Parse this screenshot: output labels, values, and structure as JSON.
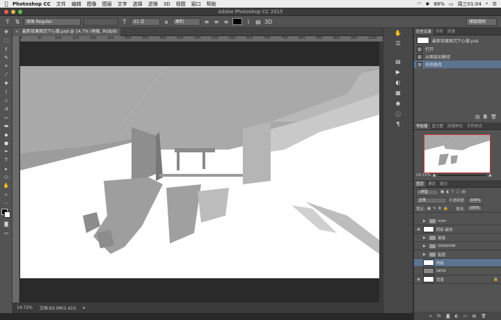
{
  "menubar": {
    "apple_icon": "apple-icon",
    "app_name": "Photoshop CC",
    "items": [
      "文件",
      "编辑",
      "图像",
      "图层",
      "文字",
      "选择",
      "滤镜",
      "3D",
      "视图",
      "窗口",
      "帮助"
    ],
    "battery": "88%",
    "clock": "周三01:04"
  },
  "window": {
    "title": "Adobe Photoshop CC 2015"
  },
  "options": {
    "font_family": "宋体 Regular",
    "font_size": "21 点",
    "aa_mode": "犀利",
    "workspace": "排版规则"
  },
  "document": {
    "tab_title": "最新效果图沉下心做.psd @ 14.7% (地板, RGB/8) *",
    "zoom": "14.72%",
    "doc_size": "文档:83.0M/1.41G"
  },
  "ruler_marks": [
    "0",
    "50",
    "100",
    "150",
    "200",
    "250",
    "300",
    "350",
    "400",
    "450",
    "500",
    "550",
    "600",
    "650",
    "700",
    "750",
    "800",
    "850",
    "900",
    "950",
    "1000"
  ],
  "history": {
    "tabs": [
      "历史记录",
      "字符",
      "段落"
    ],
    "snapshot": "最新效果图沉下心做.psd",
    "items": [
      {
        "label": "打开"
      },
      {
        "label": "从图层创建组"
      },
      {
        "label": "名称更改"
      }
    ]
  },
  "navigator": {
    "tabs": [
      "导航器",
      "直方图",
      "段落样式",
      "字符样式"
    ],
    "zoom": "14.72%"
  },
  "layers": {
    "tabs": [
      "图层",
      "通道",
      "路径"
    ],
    "filter_label": "类型",
    "blend_mode": "正常",
    "opacity_label": "不透明度:",
    "opacity": "100%",
    "lock_label": "锁定:",
    "fill_label": "填充:",
    "fill": "100%",
    "items": [
      {
        "name": "men",
        "kind": "folder"
      },
      {
        "name": "阴影 副本",
        "kind": "layer"
      },
      {
        "name": "玻璃",
        "kind": "folder"
      },
      {
        "name": "SHADOW",
        "kind": "folder"
      },
      {
        "name": "贴图",
        "kind": "folder"
      },
      {
        "name": "地板",
        "kind": "layer"
      },
      {
        "name": "SKY6",
        "kind": "layer"
      },
      {
        "name": "背景",
        "kind": "layer"
      }
    ]
  },
  "colors": {
    "accent": "#5d7491",
    "menubar": "#ececec",
    "panel": "#474747"
  }
}
